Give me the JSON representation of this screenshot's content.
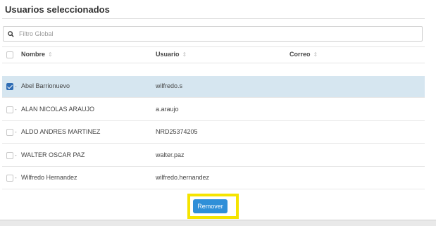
{
  "panel": {
    "title": "Usuarios seleccionados",
    "search": {
      "placeholder": "Filtro Global",
      "icon": "search-icon"
    },
    "columns": [
      {
        "label": "Nombre",
        "sort_glyph": "⇕"
      },
      {
        "label": "Usuario",
        "sort_glyph": "⇕"
      },
      {
        "label": "Correo",
        "sort_glyph": "⇕"
      }
    ],
    "rows": [
      {
        "name": "Abel Barrionuevo",
        "user": "wilfredo.s",
        "email": "",
        "checked": true
      },
      {
        "name": "ALAN NICOLAS ARAUJO",
        "user": "a.araujo",
        "email": "",
        "checked": false
      },
      {
        "name": "ALDO ANDRES MARTINEZ",
        "user": "NRD25374205",
        "email": "",
        "checked": false
      },
      {
        "name": "WALTER OSCAR PAZ",
        "user": "walter.paz",
        "email": "",
        "checked": false
      },
      {
        "name": "Wilfredo Hernandez",
        "user": "wilfredo.hernandez",
        "email": "",
        "checked": false
      }
    ],
    "remove_button": "Remover"
  },
  "colors": {
    "selected_row": "#d6e6f0",
    "button": "#2f8fd8",
    "highlight": "#f5e400",
    "checkbox_checked": "#2f6db5"
  }
}
